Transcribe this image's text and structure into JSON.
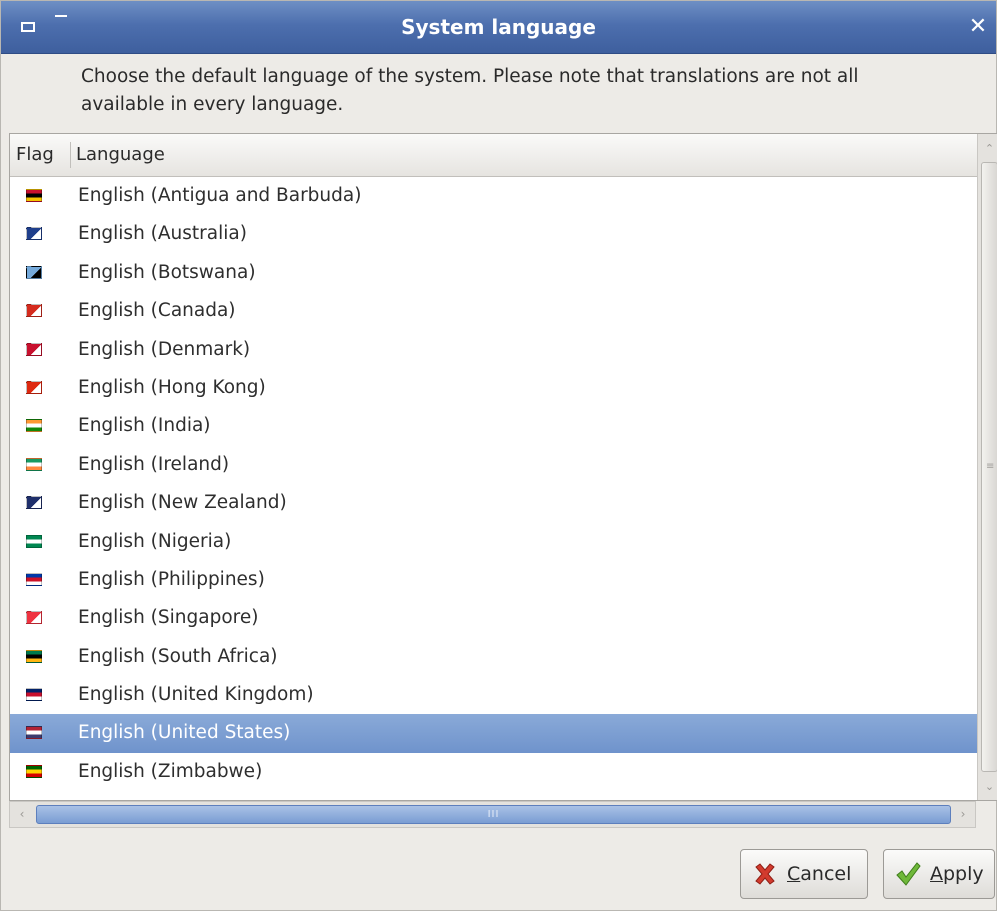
{
  "window": {
    "title": "System language",
    "description": "Choose the default language of the system. Please note that translations are not all available in every language."
  },
  "list": {
    "columns": {
      "flag": "Flag",
      "language": "Language"
    },
    "selected_index": 14,
    "items": [
      {
        "label": "English (Antigua and Barbuda)",
        "flag_icon": "antigua-flag-icon",
        "flag_colors": [
          "#c8102e",
          "#000000",
          "#f5c400"
        ]
      },
      {
        "label": "English (Australia)",
        "flag_icon": "australia-flag-icon",
        "flag_colors": [
          "#1f3f8c",
          "#ffffff"
        ]
      },
      {
        "label": "English (Botswana)",
        "flag_icon": "botswana-flag-icon",
        "flag_colors": [
          "#75aadb",
          "#000000"
        ]
      },
      {
        "label": "English (Canada)",
        "flag_icon": "canada-flag-icon",
        "flag_colors": [
          "#d52b1e",
          "#ffffff"
        ]
      },
      {
        "label": "English (Denmark)",
        "flag_icon": "denmark-flag-icon",
        "flag_colors": [
          "#c8102e",
          "#ffffff"
        ]
      },
      {
        "label": "English (Hong Kong)",
        "flag_icon": "hong-kong-flag-icon",
        "flag_colors": [
          "#de2910",
          "#ffffff"
        ]
      },
      {
        "label": "English (India)",
        "flag_icon": "india-flag-icon",
        "flag_colors": [
          "#ff9933",
          "#ffffff",
          "#138808"
        ]
      },
      {
        "label": "English (Ireland)",
        "flag_icon": "ireland-flag-icon",
        "flag_colors": [
          "#169b62",
          "#ffffff",
          "#ff883e"
        ]
      },
      {
        "label": "English (New Zealand)",
        "flag_icon": "new-zealand-flag-icon",
        "flag_colors": [
          "#1f2f6b",
          "#ffffff"
        ]
      },
      {
        "label": "English (Nigeria)",
        "flag_icon": "nigeria-flag-icon",
        "flag_colors": [
          "#008751",
          "#ffffff",
          "#008751"
        ]
      },
      {
        "label": "English (Philippines)",
        "flag_icon": "philippines-flag-icon",
        "flag_colors": [
          "#0038a8",
          "#ce1126",
          "#ffffff"
        ]
      },
      {
        "label": "English (Singapore)",
        "flag_icon": "singapore-flag-icon",
        "flag_colors": [
          "#ef3340",
          "#ffffff"
        ]
      },
      {
        "label": "English (South Africa)",
        "flag_icon": "south-africa-flag-icon",
        "flag_colors": [
          "#007a4d",
          "#000000",
          "#ffb612"
        ]
      },
      {
        "label": "English (United Kingdom)",
        "flag_icon": "united-kingdom-flag-icon",
        "flag_colors": [
          "#012169",
          "#c8102e",
          "#ffffff"
        ]
      },
      {
        "label": "English (United States)",
        "flag_icon": "united-states-flag-icon",
        "flag_colors": [
          "#b22234",
          "#ffffff",
          "#3c3b6e"
        ]
      },
      {
        "label": "English (Zimbabwe)",
        "flag_icon": "zimbabwe-flag-icon",
        "flag_colors": [
          "#006400",
          "#ffd200",
          "#d40000"
        ]
      }
    ]
  },
  "hscroll": {
    "grip": "III"
  },
  "buttons": {
    "cancel": {
      "mnemonic": "C",
      "rest": "ancel"
    },
    "apply": {
      "mnemonic": "A",
      "rest": "pply"
    }
  },
  "colors": {
    "titlebar": "#4d6fae",
    "selection": "#7a9bd0"
  }
}
